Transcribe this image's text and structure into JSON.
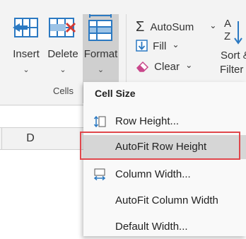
{
  "ribbon": {
    "cells_group": {
      "label": "Cells",
      "insert_label": "Insert",
      "delete_label": "Delete",
      "format_label": "Format",
      "chevron": "⌄"
    },
    "editing": {
      "autosum_label": "AutoSum",
      "fill_label": "Fill",
      "clear_label": "Clear",
      "sort_label_line1": "Sort &",
      "sort_label_line2": "Filter",
      "dropdown_caret": "⌄"
    }
  },
  "sheet": {
    "column_d": "D"
  },
  "format_menu": {
    "section_header": "Cell Size",
    "items": [
      {
        "label": "Row Height...",
        "icon": "row-height-icon"
      },
      {
        "label": "AutoFit Row Height",
        "icon": "",
        "highlighted": true
      },
      {
        "label": "Column Width...",
        "icon": "column-width-icon"
      },
      {
        "label": "AutoFit Column Width",
        "icon": ""
      },
      {
        "label": "Default Width...",
        "icon": ""
      }
    ]
  },
  "colors": {
    "accent_blue": "#2b79c2",
    "delete_red": "#d23b35",
    "highlight_border": "#e0474c",
    "eraser_pink": "#c9478b"
  }
}
